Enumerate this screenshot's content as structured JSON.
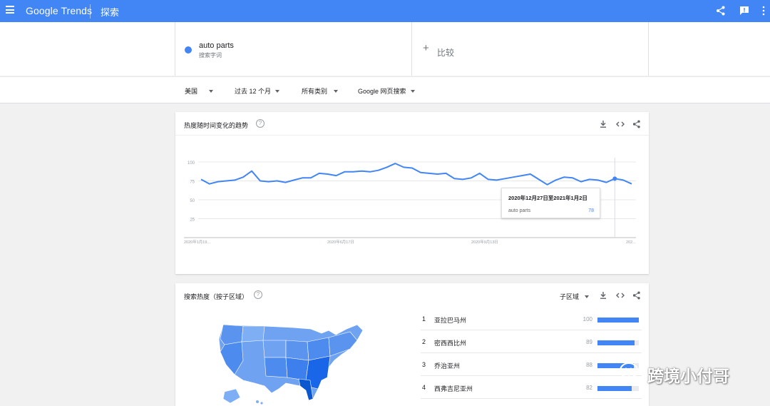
{
  "header": {
    "logo_text": "Google Trends",
    "page_title": "探索",
    "icons": [
      "menu-icon",
      "share-icon",
      "feedback-icon",
      "apps-icon"
    ]
  },
  "term": {
    "name": "auto parts",
    "type": "搜索字词",
    "color": "#4285f4",
    "compare_plus": "+",
    "compare_label": "比较"
  },
  "filters": {
    "geo": "美国",
    "time": "过去 12 个月",
    "category": "所有类别",
    "property": "Google 网页搜索"
  },
  "interest_over_time": {
    "title": "热度随时间变化的趋势",
    "help": "?",
    "tooltip": {
      "date": "2020年12月27日至2021年1月2日",
      "term": "auto parts",
      "value": "78"
    }
  },
  "chart_data": {
    "type": "line",
    "ylim": [
      0,
      100
    ],
    "yticks": [
      "100",
      "75",
      "50",
      "25"
    ],
    "xticks": [
      "2020年1月19...",
      "2020年6月17日",
      "2020年9月13日",
      "202..."
    ],
    "series": [
      {
        "name": "auto parts",
        "color": "#4285f4",
        "values": [
          77,
          71,
          74,
          75,
          76,
          80,
          88,
          75,
          74,
          75,
          73,
          76,
          79,
          79,
          85,
          84,
          82,
          87,
          87,
          88,
          87,
          89,
          93,
          98,
          93,
          92,
          86,
          85,
          84,
          85,
          78,
          77,
          79,
          85,
          77,
          76,
          78,
          80,
          82,
          84,
          77,
          70,
          76,
          80,
          79,
          74,
          77,
          76,
          73,
          78,
          76,
          71
        ]
      }
    ]
  },
  "region": {
    "title": "搜索热度（按子区域）",
    "help": "?",
    "subregion_label": "子区域",
    "rows": [
      {
        "rank": "1",
        "name": "亚拉巴马州",
        "value": "100",
        "fraction": 1.0
      },
      {
        "rank": "2",
        "name": "密西西比州",
        "value": "89",
        "fraction": 0.89
      },
      {
        "rank": "3",
        "name": "乔治亚州",
        "value": "88",
        "fraction": 0.88
      },
      {
        "rank": "4",
        "name": "西弗吉尼亚州",
        "value": "82",
        "fraction": 0.82
      }
    ]
  },
  "watermark": {
    "text": "跨境小付哥"
  }
}
